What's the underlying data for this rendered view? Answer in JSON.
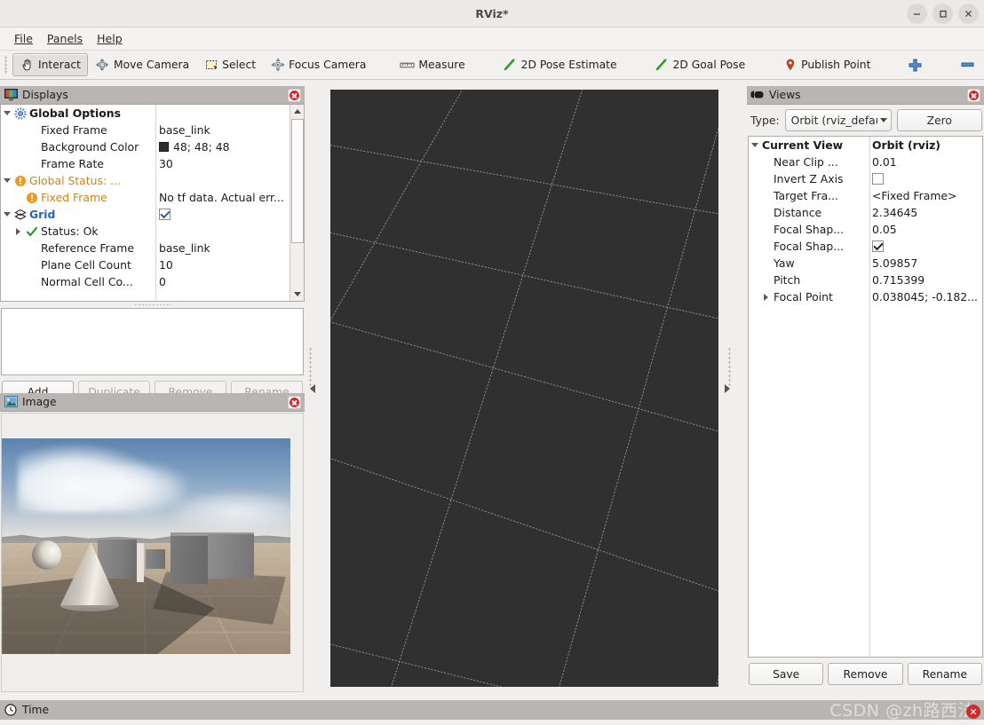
{
  "window": {
    "title": "RViz*",
    "minimize": "minimize-icon",
    "maximize": "maximize-icon",
    "close": "close-icon"
  },
  "menu": {
    "items": [
      {
        "label": "File"
      },
      {
        "label": "Panels"
      },
      {
        "label": "Help"
      }
    ]
  },
  "toolbar": {
    "items": [
      {
        "label": "Interact",
        "icon": "hand-cursor-icon",
        "checked": true
      },
      {
        "label": "Move Camera",
        "icon": "move-camera-icon",
        "checked": false
      },
      {
        "label": "Select",
        "icon": "selection-box-icon",
        "checked": false
      },
      {
        "label": "Focus Camera",
        "icon": "focus-camera-icon",
        "checked": false
      },
      {
        "label": "Measure",
        "icon": "ruler-icon",
        "checked": false
      },
      {
        "label": "2D Pose Estimate",
        "icon": "pose-arrow-icon",
        "checked": false
      },
      {
        "label": "2D Goal Pose",
        "icon": "pose-arrow-icon",
        "checked": false
      },
      {
        "label": "Publish Point",
        "icon": "map-pin-icon",
        "checked": false
      }
    ],
    "add_tool_icon": "plus-icon",
    "remove_tool_icon": "minus-icon",
    "overflow_icon": "toolbar-overflow-icon"
  },
  "displays": {
    "title": "Displays",
    "title_icon": "displays-panel-icon",
    "close_icon": "close-panel-icon",
    "rows": [
      {
        "expander": "down",
        "indent": 0,
        "icon": "gear-icon",
        "label": "Global Options",
        "style": "bold",
        "value": "",
        "value_kind": "text"
      },
      {
        "expander": "none",
        "indent": 1,
        "icon": "none",
        "label": "Fixed Frame",
        "style": "plain",
        "value": "base_link",
        "value_kind": "text"
      },
      {
        "expander": "none",
        "indent": 1,
        "icon": "none",
        "label": "Background Color",
        "style": "plain",
        "value": "48; 48; 48",
        "value_kind": "color",
        "color": "#303030"
      },
      {
        "expander": "none",
        "indent": 1,
        "icon": "none",
        "label": "Frame Rate",
        "style": "plain",
        "value": "30",
        "value_kind": "text"
      },
      {
        "expander": "down",
        "indent": 0,
        "icon": "warning-icon",
        "label": "Global Status: ...",
        "style": "warn",
        "value": "",
        "value_kind": "text"
      },
      {
        "expander": "none",
        "indent": 1,
        "icon": "warning-icon",
        "label": "Fixed Frame",
        "style": "warn",
        "value": "No tf data.  Actual err...",
        "value_kind": "text"
      },
      {
        "expander": "down",
        "indent": 0,
        "icon": "grid-icon",
        "label": "Grid",
        "style": "grid",
        "value": "checked",
        "value_kind": "checkbox"
      },
      {
        "expander": "right",
        "indent": 1,
        "icon": "check-ok-icon",
        "label": "Status: Ok",
        "style": "plain",
        "value": "",
        "value_kind": "text"
      },
      {
        "expander": "none",
        "indent": 1,
        "icon": "none",
        "label": "Reference Frame",
        "style": "plain",
        "value": "base_link",
        "value_kind": "text"
      },
      {
        "expander": "none",
        "indent": 1,
        "icon": "none",
        "label": "Plane Cell Count",
        "style": "plain",
        "value": "10",
        "value_kind": "text"
      },
      {
        "expander": "none",
        "indent": 1,
        "icon": "none",
        "label": "Normal Cell Co...",
        "style": "plain",
        "value": "0",
        "value_kind": "text"
      }
    ],
    "buttons": [
      {
        "label": "Add",
        "enabled": true
      },
      {
        "label": "Duplicate",
        "enabled": false
      },
      {
        "label": "Remove",
        "enabled": false
      },
      {
        "label": "Rename",
        "enabled": false
      }
    ],
    "description": ""
  },
  "image_panel": {
    "title": "Image",
    "title_icon": "image-panel-icon",
    "close_icon": "close-panel-icon",
    "render_description": "simulated outdoor scene: sphere, cone, grey boxes on tiled ground under cloudy sky"
  },
  "views": {
    "title": "Views",
    "title_icon": "views-panel-icon",
    "close_icon": "close-panel-icon",
    "type_label": "Type:",
    "type_value": "Orbit (rviz_defau",
    "zero_label": "Zero",
    "rows": [
      {
        "expander": "down",
        "indent": 0,
        "label": "Current View",
        "style": "bold",
        "value": "Orbit (rviz)",
        "value_kind": "text"
      },
      {
        "expander": "none",
        "indent": 1,
        "label": "Near Clip ...",
        "style": "plain",
        "value": "0.01",
        "value_kind": "text"
      },
      {
        "expander": "none",
        "indent": 1,
        "label": "Invert Z Axis",
        "style": "plain",
        "value": "unchecked",
        "value_kind": "checkbox"
      },
      {
        "expander": "none",
        "indent": 1,
        "label": "Target Fra...",
        "style": "plain",
        "value": "<Fixed Frame>",
        "value_kind": "text"
      },
      {
        "expander": "none",
        "indent": 1,
        "label": "Distance",
        "style": "plain",
        "value": "2.34645",
        "value_kind": "text"
      },
      {
        "expander": "none",
        "indent": 1,
        "label": "Focal Shap...",
        "style": "plain",
        "value": "0.05",
        "value_kind": "text"
      },
      {
        "expander": "none",
        "indent": 1,
        "label": "Focal Shap...",
        "style": "plain",
        "value": "checked",
        "value_kind": "checkbox"
      },
      {
        "expander": "none",
        "indent": 1,
        "label": "Yaw",
        "style": "plain",
        "value": "5.09857",
        "value_kind": "text"
      },
      {
        "expander": "none",
        "indent": 1,
        "label": "Pitch",
        "style": "plain",
        "value": "0.715399",
        "value_kind": "text"
      },
      {
        "expander": "right",
        "indent": 1,
        "label": "Focal Point",
        "style": "plain",
        "value": "0.038045; -0.182...",
        "value_kind": "text"
      }
    ],
    "buttons": [
      {
        "label": "Save",
        "enabled": true
      },
      {
        "label": "Remove",
        "enabled": true
      },
      {
        "label": "Rename",
        "enabled": true
      }
    ]
  },
  "viewport": {
    "background_color": "#303030",
    "grid_line_color": "#9a9a9a"
  },
  "statusbar": {
    "label": "Time",
    "icon": "clock-icon"
  },
  "watermark": {
    "text": "CSDN @zh路西法"
  },
  "colors": {
    "panel_bg": "#f0efee",
    "dock_title_bg": "#b8b5b2",
    "accent_blue": "#2166b8",
    "warn_orange": "#d08313",
    "ok_green": "#1d9b1d"
  }
}
